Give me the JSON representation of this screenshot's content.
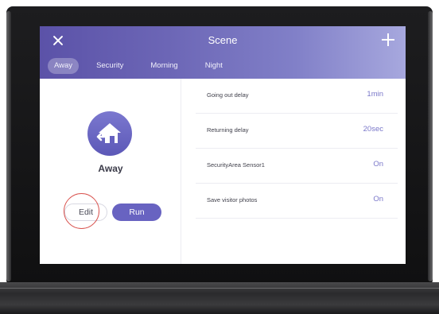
{
  "header": {
    "title": "Scene",
    "close_icon": "close-icon",
    "add_icon": "add-icon"
  },
  "tabs": [
    {
      "label": "Away",
      "active": true
    },
    {
      "label": "Security",
      "active": false
    },
    {
      "label": "Morning",
      "active": false
    },
    {
      "label": "Night",
      "active": false
    }
  ],
  "scene": {
    "icon": "home-away-icon",
    "name": "Away",
    "edit_label": "Edit",
    "run_label": "Run"
  },
  "settings": [
    {
      "label": "Going out delay",
      "value": "1min"
    },
    {
      "label": "Returning delay",
      "value": "20sec"
    },
    {
      "label": "SecurityArea Sensor1",
      "value": "On"
    },
    {
      "label": "Save visitor photos",
      "value": "On"
    }
  ],
  "colors": {
    "accent": "#6863c1",
    "header_gradient_start": "#5b52a8",
    "header_gradient_end": "#a7a8de",
    "highlight_circle": "#d9534f"
  }
}
